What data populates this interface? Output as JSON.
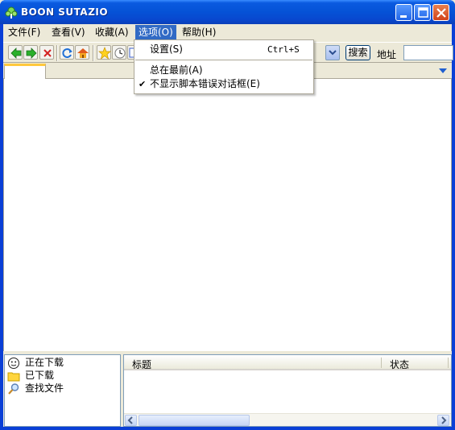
{
  "window": {
    "title": "BOON SUTAZIO",
    "controls": {
      "minimize": "minimize",
      "maximize": "maximize",
      "close": "close"
    }
  },
  "menubar": {
    "items": [
      {
        "label": "文件(F)"
      },
      {
        "label": "查看(V)"
      },
      {
        "label": "收藏(A)"
      },
      {
        "label": "选项(O)"
      },
      {
        "label": "帮助(H)"
      }
    ]
  },
  "dropdown": {
    "items": [
      {
        "label": "设置(S)",
        "shortcut": "Ctrl+S",
        "checked": false
      },
      {
        "label": "总在最前(A)",
        "checked": false
      },
      {
        "label": "不显示脚本错误对话框(E)",
        "checked": true,
        "check_mark": "✔"
      }
    ]
  },
  "toolbar": {
    "icons": [
      "back-icon",
      "forward-icon",
      "stop-icon",
      "refresh-icon",
      "home-icon",
      "favorites-icon",
      "history-icon"
    ],
    "search_label": "搜索",
    "address_label": "地址",
    "address_value": ""
  },
  "tabs": [
    {
      "label": ""
    }
  ],
  "downloads_tree": {
    "items": [
      {
        "label": "正在下载",
        "icon": "smiley-icon"
      },
      {
        "label": "已下载",
        "icon": "folder-icon"
      },
      {
        "label": "查找文件",
        "icon": "magnifier-icon"
      }
    ]
  },
  "download_list": {
    "columns": [
      {
        "label": "标题"
      },
      {
        "label": "状态"
      }
    ],
    "rows": []
  },
  "colors": {
    "titlebar": "#0552d6",
    "menu_highlight": "#316ac5",
    "window_face": "#ece9d8",
    "tab_accent": "#ffc83c"
  }
}
